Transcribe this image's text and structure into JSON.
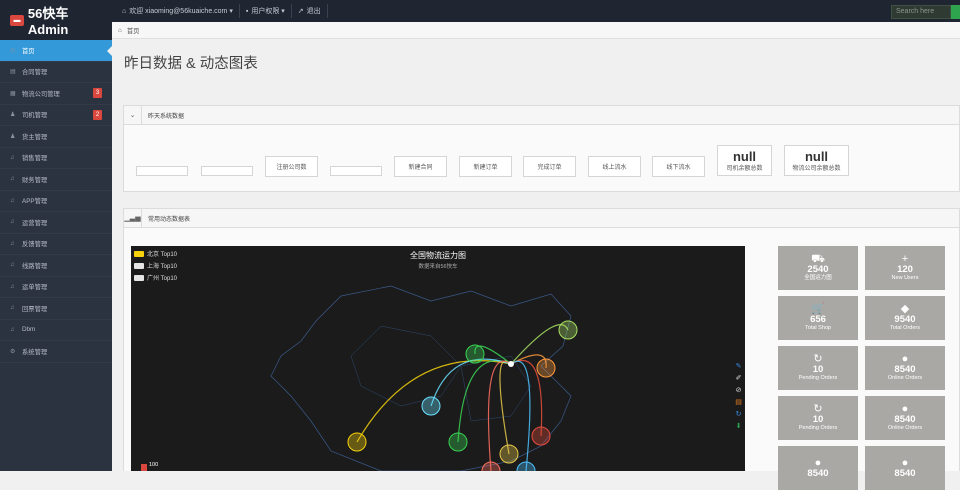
{
  "brand": {
    "name": "56快车 Admin",
    "logo_icon": "truck-icon"
  },
  "topnav": {
    "welcome": "欢迎 xiaoming@56kuaiche.com ▾",
    "settings": "用户权限 ▾",
    "logout": "退出"
  },
  "search": {
    "placeholder": "Search here"
  },
  "sidebar": {
    "items": [
      {
        "label": "首页",
        "icon": "dashboard-icon",
        "active": true
      },
      {
        "label": "合同管理",
        "icon": "document-icon"
      },
      {
        "label": "物流公司管理",
        "icon": "building-icon",
        "badge": "3"
      },
      {
        "label": "司机管理",
        "icon": "user-icon",
        "badge": "2"
      },
      {
        "label": "货主管理",
        "icon": "user-icon"
      },
      {
        "label": "销售管理",
        "icon": "bell-icon"
      },
      {
        "label": "财务管理",
        "icon": "bell-icon"
      },
      {
        "label": "APP管理",
        "icon": "bell-icon"
      },
      {
        "label": "运营管理",
        "icon": "bell-icon"
      },
      {
        "label": "反馈管理",
        "icon": "bell-icon"
      },
      {
        "label": "线路管理",
        "icon": "bell-icon"
      },
      {
        "label": "运单管理",
        "icon": "bell-icon"
      },
      {
        "label": "回票管理",
        "icon": "bell-icon"
      },
      {
        "label": "Dbm",
        "icon": "bell-icon"
      },
      {
        "label": "系统管理",
        "icon": "gear-icon"
      }
    ]
  },
  "breadcrumb": {
    "home": "首页"
  },
  "page": {
    "title": "昨日数据 & 动态图表"
  },
  "panel1": {
    "title": "昨天系统数据",
    "stats": [
      {
        "label": "",
        "value": ""
      },
      {
        "label": "",
        "value": ""
      },
      {
        "label": "注册公司数",
        "value": ""
      },
      {
        "label": "",
        "value": ""
      },
      {
        "label": "新建合同",
        "value": ""
      },
      {
        "label": "新建订单",
        "value": ""
      },
      {
        "label": "完成订单",
        "value": ""
      },
      {
        "label": "线上流水",
        "value": ""
      },
      {
        "label": "线下流水",
        "value": ""
      },
      {
        "label": "司机余额总数",
        "value": "null"
      },
      {
        "label": "物流公司余额总数",
        "value": "null"
      }
    ]
  },
  "panel2": {
    "title": "常用动态数据表"
  },
  "map": {
    "title": "全国物流运力图",
    "subtitle": "数据来自56快车",
    "legend": [
      {
        "label": "北京 Top10",
        "color": "#f5d20b"
      },
      {
        "label": "上海 Top10",
        "color": "#e6e6e6"
      },
      {
        "label": "广州 Top10",
        "color": "#e6e6e6"
      }
    ],
    "scale_label": "100"
  },
  "tiles": [
    {
      "icon": "truck-icon",
      "value": "2540",
      "label": "全国运力图"
    },
    {
      "icon": "plus-icon",
      "value": "120",
      "label": "New Users"
    },
    {
      "icon": "cart-icon",
      "value": "656",
      "label": "Total Shop"
    },
    {
      "icon": "tag-icon",
      "value": "9540",
      "label": "Total Orders"
    },
    {
      "icon": "refresh-icon",
      "value": "10",
      "label": "Pending Orders"
    },
    {
      "icon": "globe-icon",
      "value": "8540",
      "label": "Online Orders"
    },
    {
      "icon": "refresh-icon",
      "value": "10",
      "label": "Pending Orders"
    },
    {
      "icon": "globe-icon",
      "value": "8540",
      "label": "Online Orders"
    },
    {
      "icon": "globe-icon",
      "value": "8540",
      "label": ""
    },
    {
      "icon": "globe-icon",
      "value": "8540",
      "label": ""
    }
  ]
}
